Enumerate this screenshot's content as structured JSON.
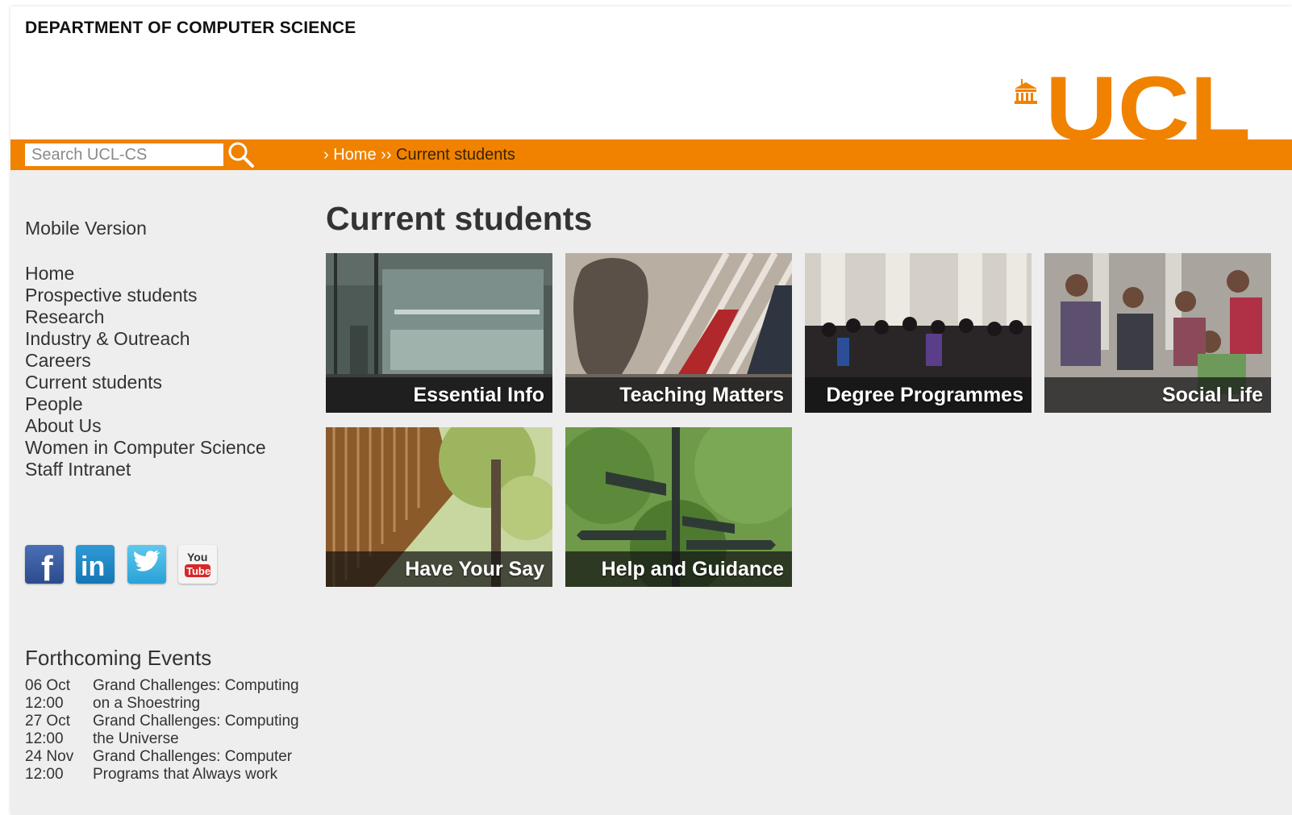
{
  "header": {
    "department": "DEPARTMENT OF COMPUTER SCIENCE",
    "logo_text": "UCL",
    "brand_color": "#f08200"
  },
  "search": {
    "placeholder": "Search UCL-CS",
    "icon": "search-icon"
  },
  "breadcrumb": {
    "sep1": "›",
    "home": "Home",
    "sep2": "››",
    "current": "Current students"
  },
  "sidebar": {
    "mobile": "Mobile Version",
    "nav": [
      "Home",
      "Prospective students",
      "Research",
      "Industry & Outreach",
      "Careers",
      "Current students",
      "People",
      "About Us",
      "Women in Computer Science",
      "Staff Intranet"
    ],
    "social": [
      {
        "icon": "facebook-icon",
        "label": "f"
      },
      {
        "icon": "linkedin-icon",
        "label": "in"
      },
      {
        "icon": "twitter-icon",
        "label": ""
      },
      {
        "icon": "youtube-icon",
        "label_top": "You",
        "label_bottom": "Tube"
      }
    ]
  },
  "events": {
    "title": "Forthcoming Events",
    "items": [
      {
        "date": "06 Oct",
        "time": "12:00",
        "line1": "Grand Challenges: Computing",
        "line2": "on a Shoestring"
      },
      {
        "date": "27 Oct",
        "time": "12:00",
        "line1": "Grand Challenges: Computing",
        "line2": "the Universe"
      },
      {
        "date": "24 Nov",
        "time": "12:00",
        "line1": "Grand Challenges: Computer",
        "line2": "Programs that Always work"
      }
    ]
  },
  "main": {
    "title": "Current students",
    "tiles": [
      {
        "label": "Essential Info"
      },
      {
        "label": "Teaching Matters"
      },
      {
        "label": "Degree Programmes"
      },
      {
        "label": "Social Life"
      },
      {
        "label": "Have Your Say"
      },
      {
        "label": "Help and Guidance"
      }
    ]
  }
}
